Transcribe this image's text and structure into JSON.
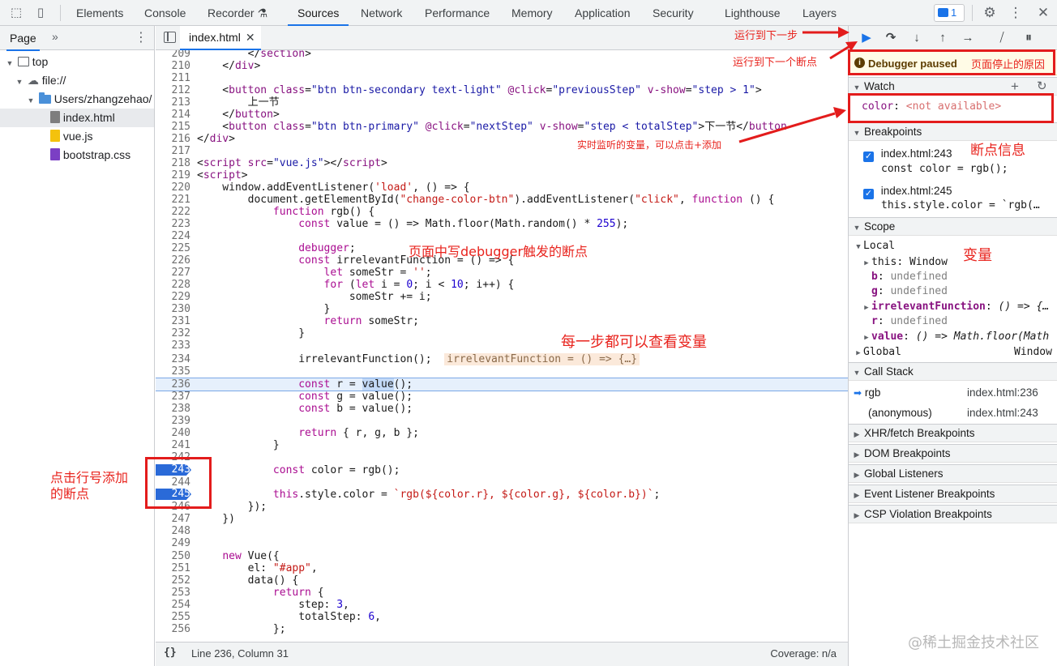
{
  "toolbar": {
    "tabs": [
      "Elements",
      "Console",
      "Recorder",
      "Sources",
      "Network",
      "Performance",
      "Memory",
      "Application",
      "Security",
      "Lighthouse",
      "Layers"
    ],
    "issues_count": "1"
  },
  "navigator": {
    "tab": "Page",
    "tree": [
      "top",
      "file://",
      "Users/zhangzehao/",
      "index.html",
      "vue.js",
      "bootstrap.css"
    ]
  },
  "editor": {
    "file_tab": "index.html",
    "status": {
      "position": "Line 236, Column 31",
      "coverage": "Coverage: n/a"
    }
  },
  "debugger": {
    "paused_label": "Debugger paused",
    "watch": {
      "title": "Watch",
      "expr": "color",
      "value": "<not available>"
    },
    "breakpoints": {
      "title": "Breakpoints",
      "items": [
        {
          "loc": "index.html:243",
          "code": "const color = rgb();"
        },
        {
          "loc": "index.html:245",
          "code": "this.style.color = `rgb(…"
        }
      ]
    },
    "scope": {
      "title": "Scope",
      "local": "Local",
      "this_key": "this",
      "this_val": "Window",
      "b_key": "b",
      "b_val": "undefined",
      "g_key": "g",
      "g_val": "undefined",
      "irr_key": "irrelevantFunction",
      "irr_val": "() => {…",
      "r_key": "r",
      "r_val": "undefined",
      "value_key": "value",
      "value_val": "() => Math.floor(Math",
      "global": "Global",
      "global_val": "Window"
    },
    "callstack": {
      "title": "Call Stack",
      "frames": [
        {
          "fn": "rgb",
          "loc": "index.html:236"
        },
        {
          "fn": "(anonymous)",
          "loc": "index.html:243"
        }
      ]
    },
    "panes": [
      "XHR/fetch Breakpoints",
      "DOM Breakpoints",
      "Global Listeners",
      "Event Listener Breakpoints",
      "CSP Violation Breakpoints"
    ]
  },
  "annotations": {
    "step_next": "运行到下一步",
    "next_breakpoint": "运行到下一个断点",
    "pause_reason": "页面停止的原因",
    "watch_hint": "实时监听的变量，可以点击+添加",
    "breakpoint_info": "断点信息",
    "variables": "变量",
    "debugger_hint": "页面中写debugger触发的断点",
    "each_step": "每一步都可以查看变量",
    "click_line": "点击行号添加\n的断点"
  },
  "watermark": "@稀土掘金技术社区"
}
